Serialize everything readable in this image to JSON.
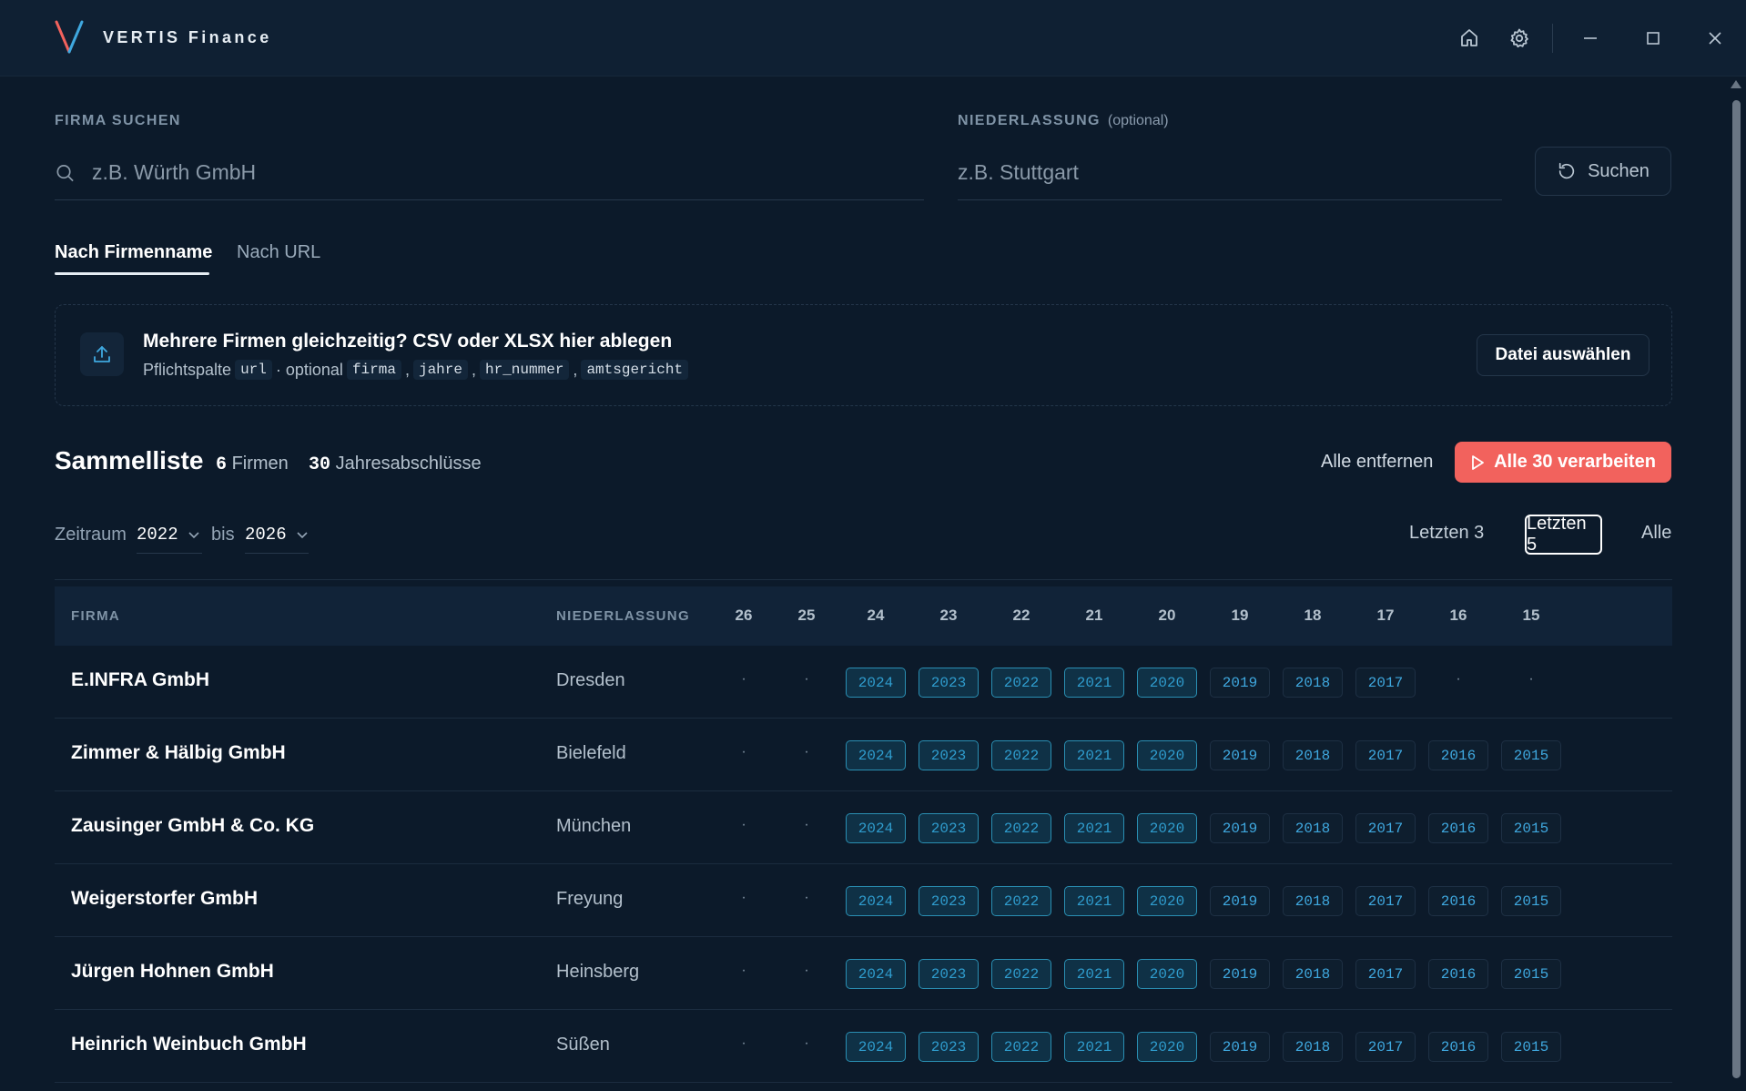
{
  "app": {
    "title": "VERTIS Finance",
    "accent": "#f2625d",
    "logo_colors": [
      "#f2625d",
      "#3fa8df"
    ]
  },
  "titlebar": {
    "icons": [
      "home-icon",
      "gear-icon",
      "minimize-icon",
      "maximize-icon",
      "close-icon"
    ]
  },
  "search": {
    "company_label": "FIRMA SUCHEN",
    "company_placeholder": "z.B. Würth GmbH",
    "company_value": "",
    "branch_label": "NIEDERLASSUNG",
    "branch_optional": "(optional)",
    "branch_placeholder": "z.B. Stuttgart",
    "branch_value": "",
    "button_label": "Suchen"
  },
  "tabs": [
    {
      "label": "Nach Firmenname",
      "active": true
    },
    {
      "label": "Nach URL",
      "active": false
    }
  ],
  "dropzone": {
    "title": "Mehrere Firmen gleichzeitig? CSV oder XLSX hier ablegen",
    "required_prefix": "Pflichtspalte",
    "required_col": "url",
    "optional_prefix": "· optional",
    "optional_cols": [
      "firma",
      "jahre",
      "hr_nummer",
      "amtsgericht"
    ],
    "separator": ",",
    "button_label": "Datei auswählen"
  },
  "collection": {
    "title": "Sammelliste",
    "firms_count": "6",
    "firms_label": "Firmen",
    "statements_count": "30",
    "statements_label": "Jahresabschlüsse",
    "remove_all_label": "Alle entfernen",
    "process_label": "Alle 30 verarbeiten"
  },
  "range": {
    "label": "Zeitraum",
    "from": "2022",
    "to_label": "bis",
    "to": "2026",
    "presets": [
      {
        "label": "Letzten 3",
        "active": false
      },
      {
        "label": "Letzten 5",
        "active": true
      },
      {
        "label": "Alle",
        "active": false
      }
    ]
  },
  "table": {
    "col_company": "FIRMA",
    "col_branch": "NIEDERLASSUNG",
    "year_headers": [
      "26",
      "25",
      "24",
      "23",
      "22",
      "21",
      "20",
      "19",
      "18",
      "17",
      "16",
      "15"
    ],
    "empty_marker": "·",
    "rows": [
      {
        "company": "E.INFRA GmbH",
        "branch": "Dresden",
        "years": [
          "",
          "",
          "2024",
          "2023",
          "2022",
          "2021",
          "2020",
          "2019",
          "2018",
          "2017",
          "",
          ""
        ],
        "selected": [
          false,
          false,
          true,
          true,
          true,
          true,
          true,
          false,
          false,
          false,
          false,
          false
        ]
      },
      {
        "company": "Zimmer & Hälbig GmbH",
        "branch": "Bielefeld",
        "years": [
          "",
          "",
          "2024",
          "2023",
          "2022",
          "2021",
          "2020",
          "2019",
          "2018",
          "2017",
          "2016",
          "2015"
        ],
        "selected": [
          false,
          false,
          true,
          true,
          true,
          true,
          true,
          false,
          false,
          false,
          false,
          false
        ]
      },
      {
        "company": "Zausinger GmbH & Co. KG",
        "branch": "München",
        "years": [
          "",
          "",
          "2024",
          "2023",
          "2022",
          "2021",
          "2020",
          "2019",
          "2018",
          "2017",
          "2016",
          "2015"
        ],
        "selected": [
          false,
          false,
          true,
          true,
          true,
          true,
          true,
          false,
          false,
          false,
          false,
          false
        ]
      },
      {
        "company": "Weigerstorfer GmbH",
        "branch": "Freyung",
        "years": [
          "",
          "",
          "2024",
          "2023",
          "2022",
          "2021",
          "2020",
          "2019",
          "2018",
          "2017",
          "2016",
          "2015"
        ],
        "selected": [
          false,
          false,
          true,
          true,
          true,
          true,
          true,
          false,
          false,
          false,
          false,
          false
        ]
      },
      {
        "company": "Jürgen Hohnen GmbH",
        "branch": "Heinsberg",
        "years": [
          "",
          "",
          "2024",
          "2023",
          "2022",
          "2021",
          "2020",
          "2019",
          "2018",
          "2017",
          "2016",
          "2015"
        ],
        "selected": [
          false,
          false,
          true,
          true,
          true,
          true,
          true,
          false,
          false,
          false,
          false,
          false
        ]
      },
      {
        "company": "Heinrich Weinbuch GmbH",
        "branch": "Süßen",
        "years": [
          "",
          "",
          "2024",
          "2023",
          "2022",
          "2021",
          "2020",
          "2019",
          "2018",
          "2017",
          "2016",
          "2015"
        ],
        "selected": [
          false,
          false,
          true,
          true,
          true,
          true,
          true,
          false,
          false,
          false,
          false,
          false
        ]
      }
    ]
  }
}
